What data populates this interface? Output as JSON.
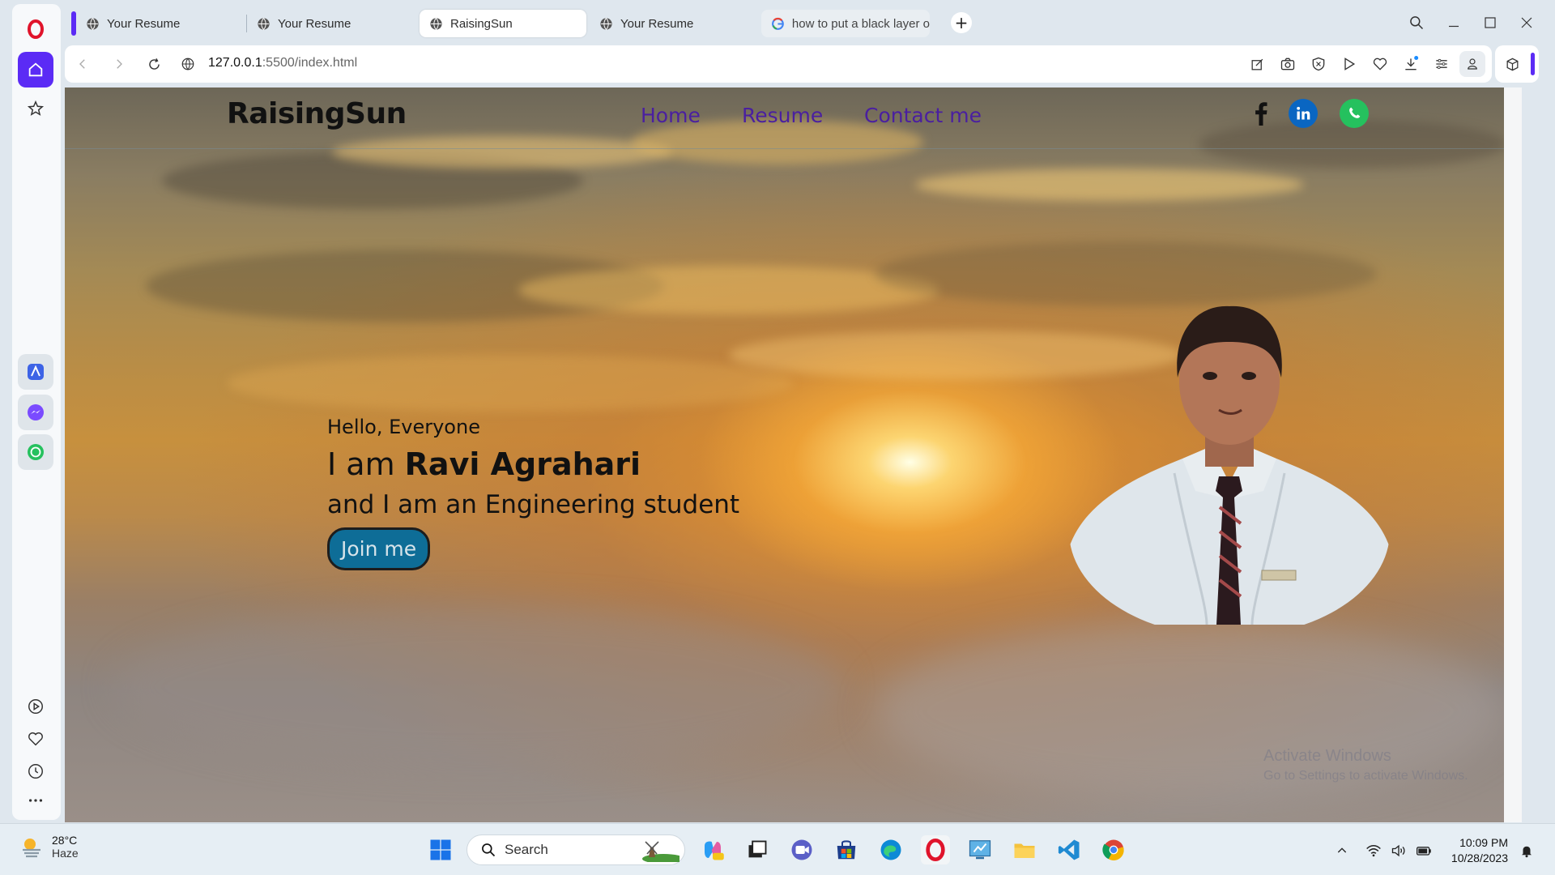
{
  "browser": {
    "tabs": [
      {
        "label": "Your Resume",
        "active": false
      },
      {
        "label": "Your Resume",
        "active": false
      },
      {
        "label": "RaisingSun",
        "active": true
      },
      {
        "label": "Your Resume",
        "active": false
      },
      {
        "label": "how to put a black layer o",
        "active": false
      }
    ],
    "url_host": "127.0.0.1",
    "url_path": ":5500/index.html",
    "accent": "#5b2bf5"
  },
  "site": {
    "brand": "RaisingSun",
    "nav": [
      "Home",
      "Resume",
      "Contact me"
    ],
    "nav_color": "#4a1fa0",
    "social": [
      "facebook-icon",
      "linkedin-icon",
      "whatsapp-icon"
    ],
    "hero": {
      "greeting": "Hello, Everyone",
      "iam_prefix": "I am ",
      "name": "Ravi Agrahari",
      "description": "and I am an Engineering student",
      "cta": "Join me"
    },
    "cta_color": "#0e6d97"
  },
  "watermark": {
    "line1": "Activate Windows",
    "line2": "Go to Settings to activate Windows."
  },
  "taskbar": {
    "weather_temp": "28°C",
    "weather_desc": "Haze",
    "search_label": "Search",
    "time": "10:09 PM",
    "date": "10/28/2023"
  }
}
